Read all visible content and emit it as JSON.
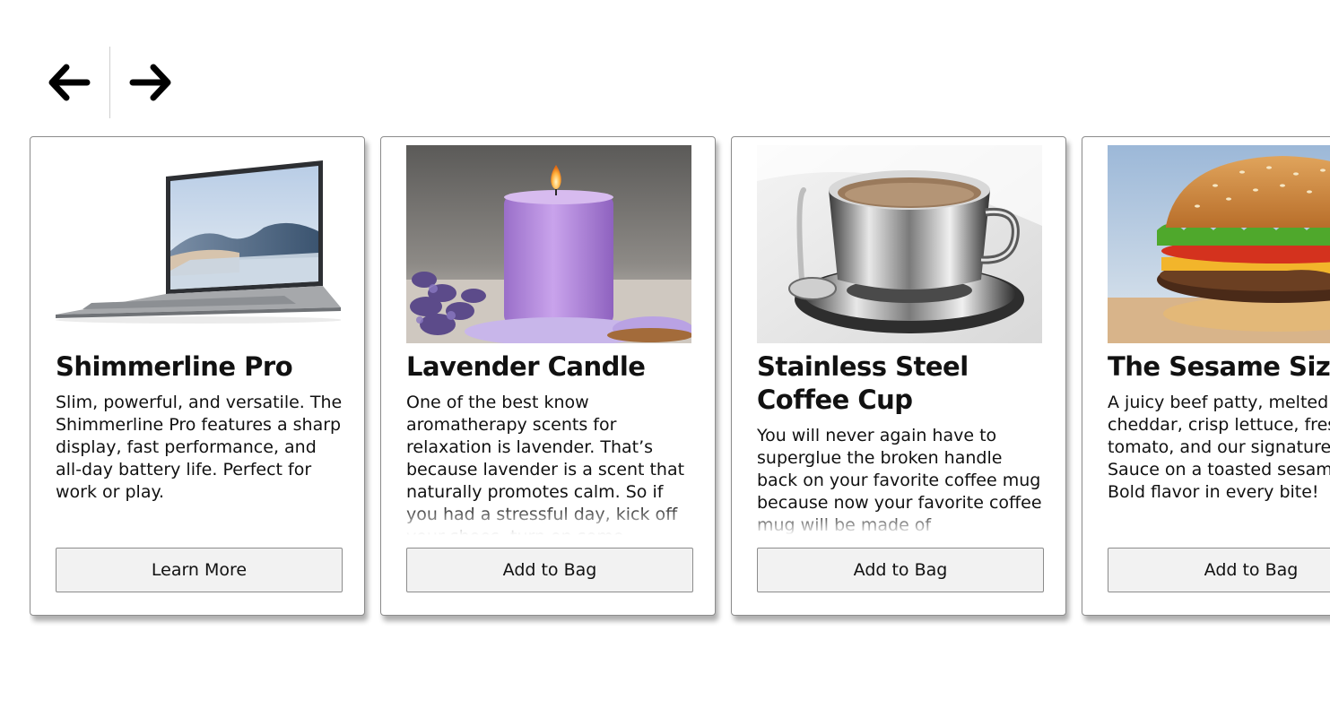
{
  "nav": {
    "prev_icon": "arrow-left-icon",
    "next_icon": "arrow-right-icon"
  },
  "products": [
    {
      "image": "laptop-image",
      "title": "Shimmerline Pro",
      "description": "Slim, powerful, and versatile. The Shimmerline Pro features a sharp display, fast performance, and all-day battery life. Perfect for work or play.",
      "button": "Learn More"
    },
    {
      "image": "candle-image",
      "title": "Lavender Candle",
      "description": "One of the best know aromatherapy scents for relaxation is lavender. That’s because lavender is a scent that naturally promotes calm. So if you had a stressful day, kick off your shoes, turn on some",
      "button": "Add to Bag"
    },
    {
      "image": "coffee-cup-image",
      "title": "Stainless Steel Coffee Cup",
      "description": "You will never again have to superglue the broken handle back on your favorite coffee mug because now your favorite coffee mug will be made of",
      "button": "Add to Bag"
    },
    {
      "image": "burger-image",
      "title": "The Sesame Sizzle",
      "description": "A juicy beef patty, melted cheddar, crisp lettuce, fresh tomato, and our signature House Sauce on a toasted sesame bun. Bold flavor in every bite!",
      "button": "Add to Bag"
    }
  ]
}
